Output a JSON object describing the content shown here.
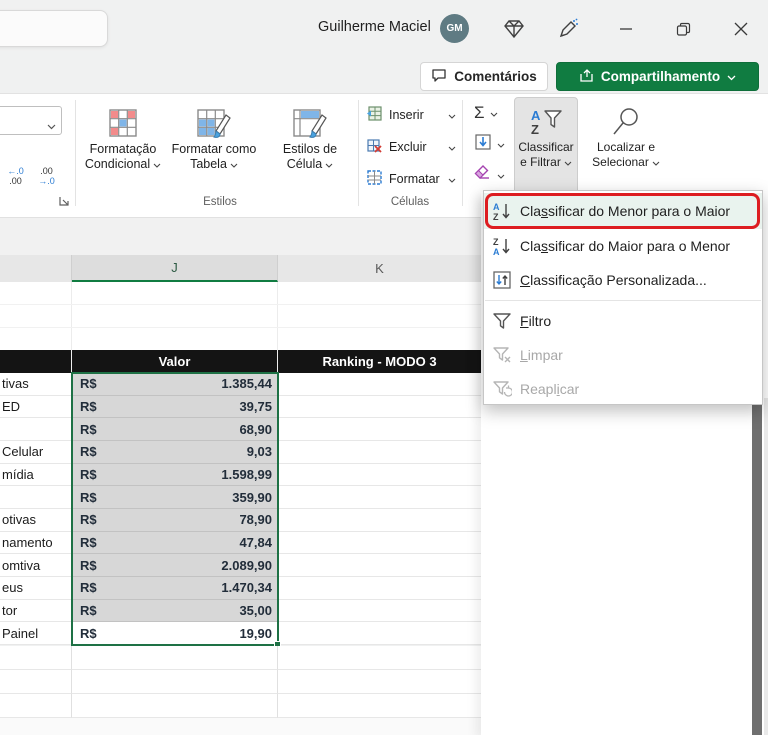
{
  "titlebar": {
    "user_name": "Guilherme Maciel",
    "avatar_initials": "GM"
  },
  "actions": {
    "comments_label": "Comentários",
    "share_label": "Compartilhamento"
  },
  "ribbon": {
    "number": {
      "dec1_top": "←.0",
      "dec1_bottom": ".00",
      "dec2_top": ".00",
      "dec2_bottom": "→.0"
    },
    "styles": {
      "group_label": "Estilos",
      "conditional_line1": "Formatação",
      "conditional_line2": "Condicional",
      "format_table_line1": "Formatar como",
      "format_table_line2": "Tabela",
      "cell_styles_line1": "Estilos de",
      "cell_styles_line2": "Célula"
    },
    "cells": {
      "group_label": "Células",
      "insert_label": "Inserir",
      "delete_label": "Excluir",
      "format_label": "Formatar"
    },
    "editing": {
      "autosum_symbol": "Σ",
      "sort_filter_line1": "Classificar",
      "sort_filter_line2": "e Filtrar",
      "find_line1": "Localizar e",
      "find_line2": "Selecionar"
    }
  },
  "sort_menu": {
    "items": [
      {
        "prefix": "Cla",
        "accel": "s",
        "suffix": "sificar do Menor para o Maior"
      },
      {
        "prefix": "Cla",
        "accel": "s",
        "suffix": "sificar do Maior para o Menor"
      },
      {
        "prefix": "",
        "accel": "C",
        "suffix": "lassificação Personalizada..."
      },
      {
        "prefix": "",
        "accel": "F",
        "suffix": "iltro"
      },
      {
        "prefix": "",
        "accel": "L",
        "suffix": "impar"
      },
      {
        "prefix": "Reapl",
        "accel": "i",
        "suffix": "car"
      }
    ]
  },
  "sheet": {
    "column_headers": {
      "j": "J",
      "k": "K"
    },
    "table_header": {
      "valor": "Valor",
      "ranking": "Ranking - MODO 3"
    },
    "currency_symbol": "R$",
    "rows": [
      {
        "label": "tivas",
        "value": "1.385,44"
      },
      {
        "label": "ED",
        "value": "39,75"
      },
      {
        "label": "",
        "value": "68,90"
      },
      {
        "label": "Celular",
        "value": "9,03"
      },
      {
        "label": "mídia",
        "value": "1.598,99"
      },
      {
        "label": "",
        "value": "359,90"
      },
      {
        "label": "otivas",
        "value": "78,90"
      },
      {
        "label": "namento",
        "value": "47,84"
      },
      {
        "label": "omtiva",
        "value": "2.089,90"
      },
      {
        "label": "eus",
        "value": "1.470,34"
      },
      {
        "label": "tor",
        "value": "35,00"
      },
      {
        "label": "Painel",
        "value": "19,90"
      }
    ]
  },
  "colors": {
    "excel_green": "#107c41",
    "selection_green": "#1e7145",
    "annotation_red": "#dd1d21",
    "selected_cell_bg": "#d7d7d7",
    "table_header_bg": "#141414"
  }
}
